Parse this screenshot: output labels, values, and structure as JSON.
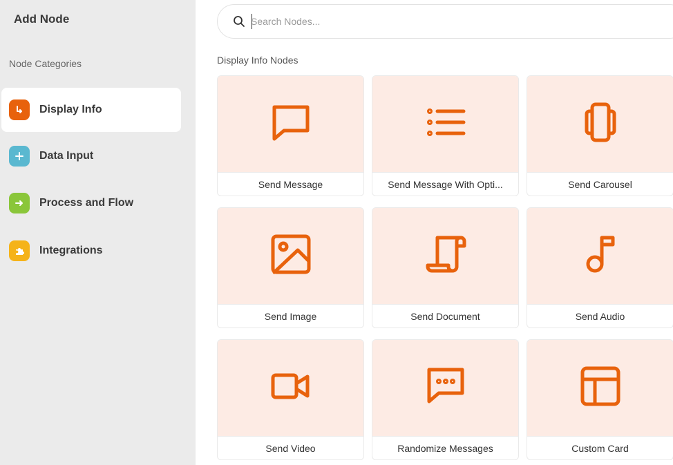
{
  "panel": {
    "title": "Add Node"
  },
  "categories": {
    "heading": "Node Categories",
    "items": [
      {
        "label": "Display Info",
        "color": "#e8620c",
        "icon": "display-info-icon",
        "active": true
      },
      {
        "label": "Data Input",
        "color": "#5ab8d0",
        "icon": "plus-icon",
        "active": false
      },
      {
        "label": "Process and Flow",
        "color": "#8ac63a",
        "icon": "arrow-right-icon",
        "active": false
      },
      {
        "label": "Integrations",
        "color": "#f5b319",
        "icon": "puzzle-icon",
        "active": false
      }
    ]
  },
  "search": {
    "placeholder": "Search Nodes...",
    "value": ""
  },
  "section": {
    "title": "Display Info Nodes"
  },
  "theme": {
    "accent": "#e8620c",
    "card_bg": "#fdebe4"
  },
  "nodes": [
    {
      "label": "Send Message",
      "icon": "message-square-icon"
    },
    {
      "label": "Send Message With Opti...",
      "icon": "list-icon"
    },
    {
      "label": "Send Carousel",
      "icon": "carousel-icon"
    },
    {
      "label": "Send Image",
      "icon": "image-icon"
    },
    {
      "label": "Send Document",
      "icon": "scroll-document-icon"
    },
    {
      "label": "Send Audio",
      "icon": "music-note-icon"
    },
    {
      "label": "Send Video",
      "icon": "video-camera-icon"
    },
    {
      "label": "Randomize Messages",
      "icon": "message-dots-icon"
    },
    {
      "label": "Custom Card",
      "icon": "layout-card-icon"
    }
  ]
}
